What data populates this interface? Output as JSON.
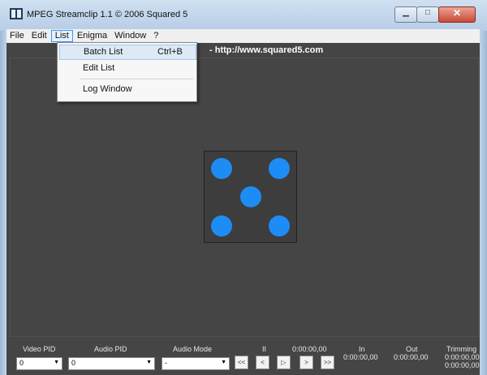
{
  "window": {
    "title": "MPEG Streamclip 1.1 © 2006  Squared 5",
    "controls": [
      "minimize",
      "maximize",
      "close"
    ]
  },
  "menubar": {
    "items": [
      "File",
      "Edit",
      "List",
      "Enigma",
      "Window",
      "?"
    ],
    "active": "List"
  },
  "list_menu": {
    "items": [
      {
        "label": "Batch List",
        "shortcut": "Ctrl+B",
        "highlighted": true
      },
      {
        "label": "Edit List",
        "shortcut": ""
      },
      {
        "label": "Log Window",
        "shortcut": ""
      }
    ]
  },
  "main": {
    "url_text": "- http://www.squared5.com",
    "logo_dot_color": "#1e8cf5"
  },
  "bottom": {
    "video_pid_label": "Video PID",
    "video_pid_value": "0",
    "audio_pid_label": "Audio PID",
    "audio_pid_value": "0",
    "audio_mode_label": "Audio Mode",
    "audio_mode_value": "-",
    "pause_label": "II",
    "current_time": "0:00:00,00",
    "in_label": "In",
    "in_time": "0:00:00,00",
    "out_label": "Out",
    "out_time": "0:00:00,00",
    "trimming_label": "Trimming",
    "trimming_time_1": "0:00:00,00",
    "trimming_time_2": "0:00:00,00",
    "transport": [
      "<<",
      "<",
      "▷",
      ">",
      ">>"
    ]
  }
}
